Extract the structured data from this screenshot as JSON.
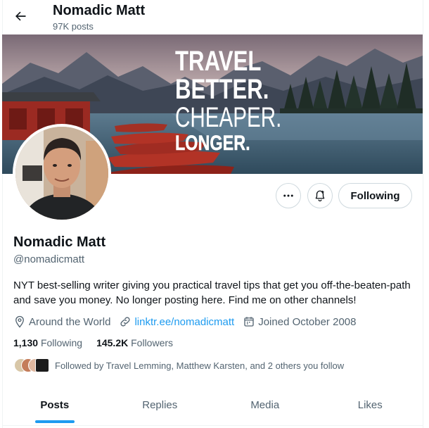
{
  "header": {
    "title": "Nomadic Matt",
    "post_count": "97K posts"
  },
  "banner": {
    "line1": "TRAVEL",
    "line2": "BETTER.",
    "line3": "CHEAPER.",
    "line4": "LONGER."
  },
  "profile": {
    "name": "Nomadic Matt",
    "handle": "@nomadicmatt",
    "bio": "NYT best-selling writer giving you practical travel tips that get you off-the-beaten-path and save you money. No longer posting here. Find me on other channels!",
    "location": "Around the World",
    "website": "linktr.ee/nomadicmatt",
    "joined": "Joined October 2008"
  },
  "actions": {
    "follow_label": "Following",
    "more_icon": "more-icon",
    "notify_icon": "bell-plus-icon"
  },
  "stats": {
    "following_count": "1,130",
    "following_label": "Following",
    "followers_count": "145.2K",
    "followers_label": "Followers"
  },
  "followed_by": "Followed by Travel Lemming, Matthew Karsten, and 2 others you follow",
  "tabs": [
    {
      "label": "Posts",
      "active": true
    },
    {
      "label": "Replies",
      "active": false
    },
    {
      "label": "Media",
      "active": false
    },
    {
      "label": "Likes",
      "active": false
    }
  ],
  "colors": {
    "accent": "#1d9bf0",
    "text": "#0f1419",
    "secondary": "#536471",
    "border": "#cfd9de"
  }
}
